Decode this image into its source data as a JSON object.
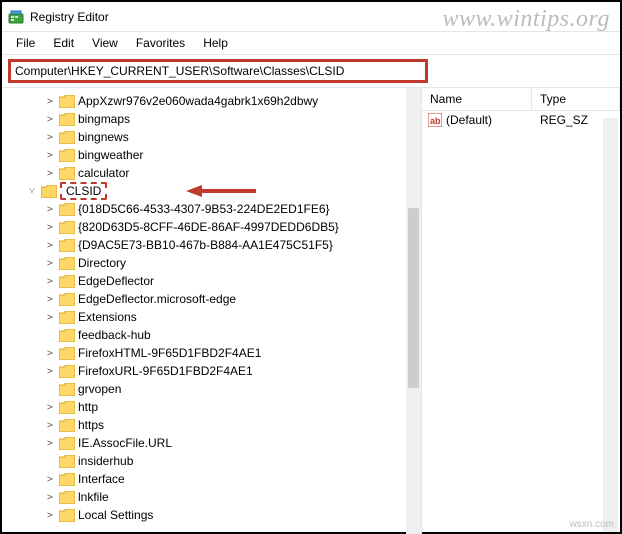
{
  "window": {
    "title": "Registry Editor"
  },
  "watermark": "www.wintips.org",
  "wsxn": "wsxn.com",
  "menubar": {
    "file": "File",
    "edit": "Edit",
    "view": "View",
    "favorites": "Favorites",
    "help": "Help"
  },
  "address": "Computer\\HKEY_CURRENT_USER\\Software\\Classes\\CLSID",
  "tree": {
    "root": [
      {
        "label": "AppXzwr976v2e060wada4gabrk1x69h2dbwy",
        "expandable": true
      },
      {
        "label": "bingmaps",
        "expandable": true
      },
      {
        "label": "bingnews",
        "expandable": true
      },
      {
        "label": "bingweather",
        "expandable": true
      },
      {
        "label": "calculator",
        "expandable": true
      }
    ],
    "clsid_label": "CLSID",
    "clsid_children": [
      {
        "label": "{018D5C66-4533-4307-9B53-224DE2ED1FE6}",
        "expandable": true
      },
      {
        "label": "{820D63D5-8CFF-46DE-86AF-4997DEDD6DB5}",
        "expandable": true
      },
      {
        "label": "{D9AC5E73-BB10-467b-B884-AA1E475C51F5}",
        "expandable": true
      }
    ],
    "after": [
      {
        "label": "Directory",
        "expandable": true
      },
      {
        "label": "EdgeDeflector",
        "expandable": true
      },
      {
        "label": "EdgeDeflector.microsoft-edge",
        "expandable": true
      },
      {
        "label": "Extensions",
        "expandable": true
      },
      {
        "label": "feedback-hub",
        "expandable": false
      },
      {
        "label": "FirefoxHTML-9F65D1FBD2F4AE1",
        "expandable": true
      },
      {
        "label": "FirefoxURL-9F65D1FBD2F4AE1",
        "expandable": true
      },
      {
        "label": "grvopen",
        "expandable": false
      },
      {
        "label": "http",
        "expandable": true
      },
      {
        "label": "https",
        "expandable": true
      },
      {
        "label": "IE.AssocFile.URL",
        "expandable": true
      },
      {
        "label": "insiderhub",
        "expandable": false
      },
      {
        "label": "Interface",
        "expandable": true
      },
      {
        "label": "lnkfile",
        "expandable": true
      },
      {
        "label": "Local Settings",
        "expandable": true
      }
    ]
  },
  "values": {
    "headers": {
      "name": "Name",
      "type": "Type"
    },
    "rows": [
      {
        "name": "(Default)",
        "type": "REG_SZ"
      }
    ]
  }
}
